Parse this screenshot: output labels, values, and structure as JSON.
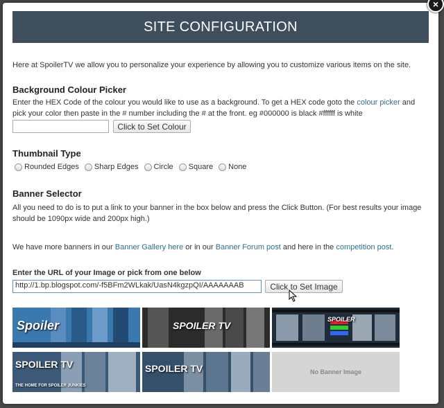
{
  "modal": {
    "title": "SITE CONFIGURATION",
    "intro": "Here at SpoilerTV we allow you to personalize your experience by allowing you to customize various items on the site."
  },
  "background": {
    "heading": "Background Colour Picker",
    "desc_part1": "Enter the HEX Code of the colour you would like to use as a background. To get a HEX code goto the ",
    "link": "colour picker",
    "desc_part2": " and pick your color then paste in the # number including the # at the front. eg #000000 is black #ffffff is white",
    "input_value": "",
    "button": "Click to Set Colour"
  },
  "thumbnail": {
    "heading": "Thumbnail Type",
    "options": [
      "Rounded Edges",
      "Sharp Edges",
      "Circle",
      "Square",
      "None"
    ]
  },
  "banner": {
    "heading": "Banner Selector",
    "desc": "All you need to do is to put a link to your banner in the box below and press the Click Button. (For best results your image should be 1090px wide and 200px high.)",
    "more_part1": "We have more banners in our ",
    "gallery_link": "Banner Gallery here",
    "more_part2": " or in our ",
    "forum_link": "Banner Forum post",
    "more_part3": " and here in the ",
    "competition_link": "competition post",
    "more_part4": ".",
    "url_label": "Enter the URL of your Image or pick from one below",
    "url_value": "http://1.bp.blogspot.com/-f5BFm2WLkak/UasN4kgzpQI/AAAAAAAB",
    "button": "Click to Set Image",
    "thumbs": [
      {
        "text": "Spoiler",
        "color": "#3a78b0"
      },
      {
        "text": "SPOILER TV",
        "color": "#2b2b2b"
      },
      {
        "text": "SPOILER",
        "color": "#1f2c3a"
      },
      {
        "text": "SPOILER TV",
        "color": "#3c5a78",
        "caption": "THE HOME FOR SPOILER JUNKIES"
      },
      {
        "text": "SPOILER TV",
        "color": "#35506b"
      }
    ],
    "no_banner": "No Banner Image"
  },
  "close_label": "×"
}
